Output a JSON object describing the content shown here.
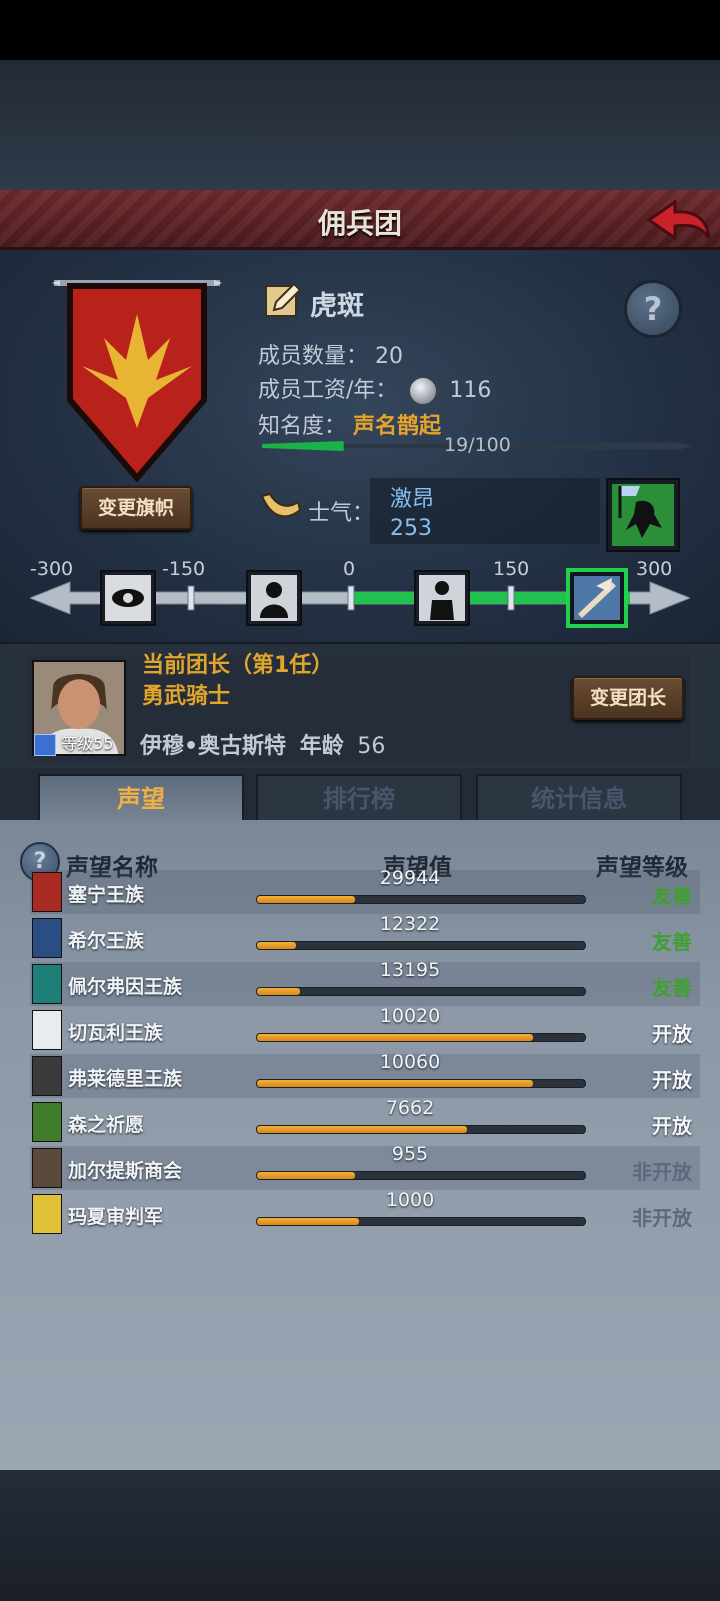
{
  "header": {
    "title": "佣兵团"
  },
  "team": {
    "name": "虎斑",
    "change_banner_label": "变更旗帜",
    "members_label": "成员数量：",
    "members_value": "20",
    "wage_label": "成员工资/年：",
    "wage_value": "116",
    "fame_label": "知名度：",
    "fame_title": "声名鹊起",
    "fame_progress_text": "19/100",
    "fame_progress": 0.19
  },
  "morale": {
    "label": "士气：",
    "state": "激昂",
    "value": "253",
    "scale": [
      "-300",
      "-150",
      "0",
      "150",
      "300"
    ]
  },
  "leader": {
    "title": "当前团长（第1任）",
    "class": "勇武骑士",
    "name": "伊穆•奥古斯特",
    "age_label": "年龄",
    "age_value": "56",
    "level_label": "等级55",
    "change_leader_label": "变更团长"
  },
  "tabs": [
    {
      "label": "声望"
    },
    {
      "label": "排行榜"
    },
    {
      "label": "统计信息"
    }
  ],
  "reputation": {
    "col_name": "声望名称",
    "col_value": "声望值",
    "col_level": "声望等级",
    "rows": [
      {
        "name": "塞宁王族",
        "value": "29944",
        "level": "友善",
        "fill": 0.3,
        "level_type": "friendly",
        "icon_color": "#a92a22"
      },
      {
        "name": "希尔王族",
        "value": "12322",
        "level": "友善",
        "fill": 0.12,
        "level_type": "friendly",
        "icon_color": "#2a4d86"
      },
      {
        "name": "佩尔弗因王族",
        "value": "13195",
        "level": "友善",
        "fill": 0.13,
        "level_type": "friendly",
        "icon_color": "#1e7f79"
      },
      {
        "name": "切瓦利王族",
        "value": "10020",
        "level": "开放",
        "fill": 0.84,
        "level_type": "open",
        "icon_color": "#e9ecef"
      },
      {
        "name": "弗莱德里王族",
        "value": "10060",
        "level": "开放",
        "fill": 0.84,
        "level_type": "open",
        "icon_color": "#3a3a3a"
      },
      {
        "name": "森之祈愿",
        "value": "7662",
        "level": "开放",
        "fill": 0.64,
        "level_type": "open",
        "icon_color": "#3f7d2a"
      },
      {
        "name": "加尔提斯商会",
        "value": "955",
        "level": "非开放",
        "fill": 0.3,
        "level_type": "closed",
        "icon_color": "#5a4a3a"
      },
      {
        "name": "玛夏审判军",
        "value": "1000",
        "level": "非开放",
        "fill": 0.31,
        "level_type": "closed",
        "icon_color": "#e0c23a"
      }
    ]
  }
}
